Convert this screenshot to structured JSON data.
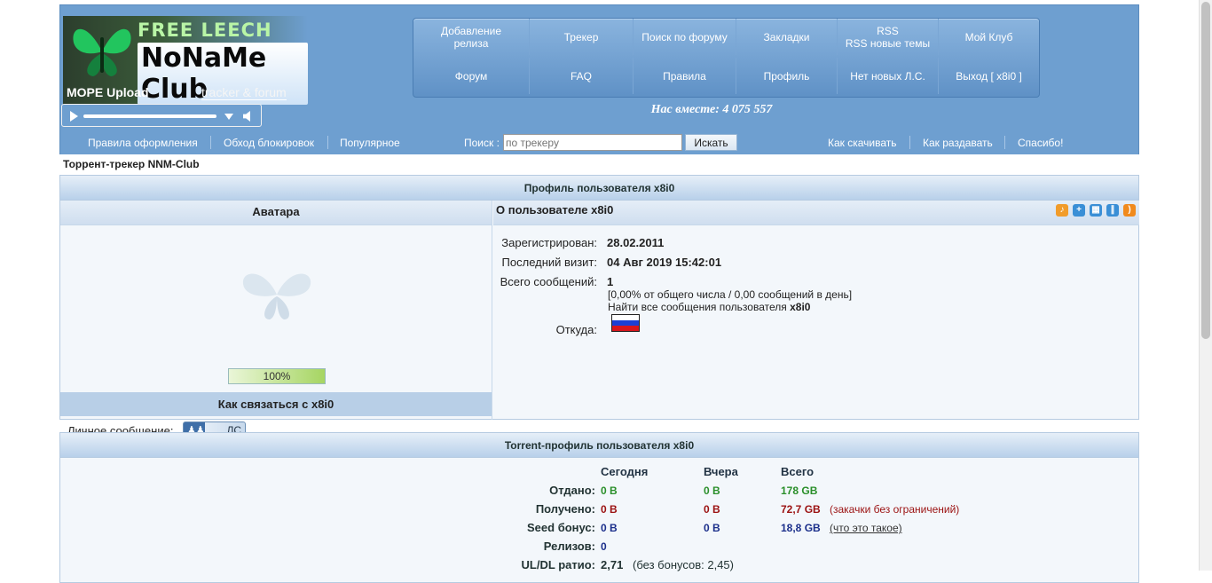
{
  "header": {
    "logo": {
      "top": "FREE LEECH DAY",
      "name": "NoNaMe Club",
      "upload": "MOPE Upload",
      "tagline": "tracker & forum"
    },
    "nav_top": [
      "Добавление релиза",
      "Трекер",
      "Поиск по форуму",
      "Закладки",
      "RSS\nRSS новые темы",
      "Мой Клуб"
    ],
    "nav_bottom": [
      "Форум",
      "FAQ",
      "Правила",
      "Профиль",
      "Нет новых Л.С.",
      "Выход [ x8i0 ]"
    ],
    "online": "Нас вместе: 4 075 557"
  },
  "subbar": {
    "links_left": [
      "Правила оформления",
      "Обход блокировок",
      "Популярное"
    ],
    "search_label": "Поиск :",
    "search_placeholder": "по трекеру",
    "search_button": "Искать",
    "links_right": [
      "Как скачивать",
      "Как раздавать",
      "Спасибо!"
    ]
  },
  "breadcrumb": "Торрент-трекер NNM-Club",
  "profile": {
    "title": "Профиль пользователя x8i0",
    "avatar_title": "Аватара",
    "progress": "100%",
    "contact_title": "Как связаться с x8i0",
    "pm_label": "Личное сообщение:",
    "pm_button": "ЛС",
    "about_title": "О пользователе x8i0",
    "registered_label": "Зарегистрирован:",
    "registered_value": "28.02.2011",
    "last_visit_label": "Последний визит:",
    "last_visit_value": "04 Авг 2019 15:42:01",
    "posts_label": "Всего сообщений:",
    "posts_value": "1",
    "posts_stats": "[0,00% от общего числа / 0,00 сообщений в день]",
    "find_posts_prefix": "Найти все сообщения пользователя",
    "find_posts_user": "x8i0",
    "from_label": "Откуда:"
  },
  "torrent_profile": {
    "title": "Torrent-профиль пользователя x8i0",
    "columns": [
      "Сегодня",
      "Вчера",
      "Всего"
    ],
    "rows": [
      {
        "label": "Отдано:",
        "today": "0 B",
        "yesterday": "0 B",
        "total": "178 GB",
        "note": ""
      },
      {
        "label": "Получено:",
        "today": "0 B",
        "yesterday": "0 B",
        "total": "72,7 GB",
        "note": "(закачки без ограничений)"
      },
      {
        "label": "Seed бонус:",
        "today": "0 B",
        "yesterday": "0 B",
        "total": "18,8 GB",
        "note": "(что это такое)"
      },
      {
        "label": "Релизов:",
        "today": "0",
        "yesterday": "",
        "total": "",
        "note": ""
      },
      {
        "label": "UL/DL ратио:",
        "today": "2,71",
        "yesterday": "",
        "total": "",
        "note": "(без бонусов: 2,45)"
      }
    ]
  }
}
